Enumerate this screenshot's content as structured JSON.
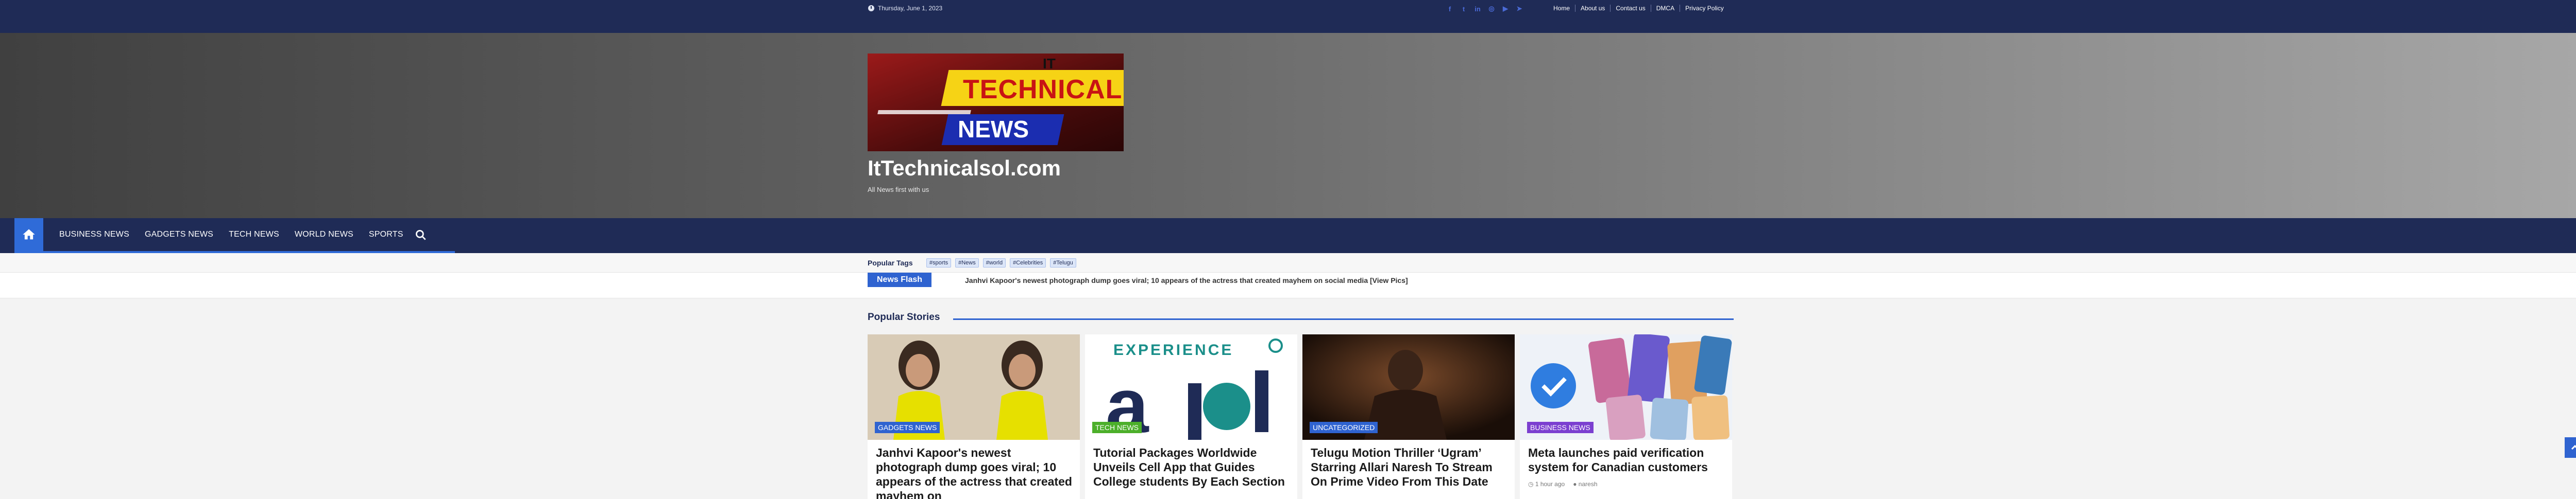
{
  "topbar": {
    "date": "Thursday, June 1, 2023",
    "social_icons": [
      "facebook-icon",
      "twitter-icon",
      "linkedin-icon",
      "instagram-icon",
      "youtube-icon",
      "telegram-icon"
    ],
    "links": [
      "Home",
      "About us",
      "Contact us",
      "DMCA",
      "Privacy Policy"
    ]
  },
  "header": {
    "logo": {
      "line1": "IT",
      "line2": "TECHNICAL",
      "line3": "NEWS"
    },
    "site_title": "ItTechnicalsol.com",
    "tagline": "All News first with us"
  },
  "nav": {
    "items": [
      "BUSINESS NEWS",
      "GADGETS NEWS",
      "TECH NEWS",
      "WORLD NEWS",
      "SPORTS"
    ]
  },
  "popular_tags": {
    "label": "Popular Tags",
    "tags": [
      "#sports",
      "#News",
      "#world",
      "#Celebrities",
      "#Telugu"
    ]
  },
  "news_flash": {
    "label": "News Flash",
    "text": "Janhvi Kapoor's newest photograph dump goes viral; 10 appears of the actress that created mayhem on social media [View Pics]"
  },
  "popular_stories": {
    "heading": "Popular Stories",
    "cards": [
      {
        "category": "GADGETS NEWS",
        "category_color": "#2f63d0",
        "title": "Janhvi Kapoor's newest photograph dump goes viral; 10 appears of the actress that created mayhem on",
        "time": "",
        "author": ""
      },
      {
        "category": "TECH NEWS",
        "category_color": "#4caf2a",
        "title": "Tutorial Packages Worldwide Unveils Cell App that Guides College students By Each Section",
        "time": "",
        "author": ""
      },
      {
        "category": "UNCATEGORIZED",
        "category_color": "#2f63d0",
        "title": "Telugu Motion Thriller ‘Ugram’ Starring Allari Naresh To Stream On Prime Video From This Date",
        "time": "",
        "author": ""
      },
      {
        "category": "BUSINESS NEWS",
        "category_color": "#7b3fd0",
        "title": "Meta launches paid verification system for Canadian customers",
        "time": "1 hour ago",
        "author": "naresh"
      }
    ]
  }
}
